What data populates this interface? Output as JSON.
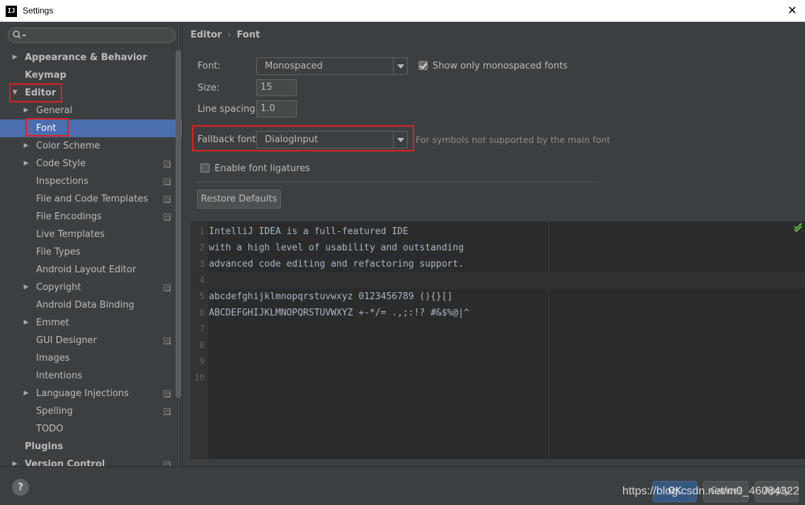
{
  "window": {
    "title": "Settings",
    "app_icon_text": "IJ",
    "close_glyph": "✕"
  },
  "sidebar": {
    "search_placeholder": "",
    "items": [
      {
        "label": "Appearance & Behavior",
        "level": 0,
        "arrow": "▶",
        "bold": true
      },
      {
        "label": "Keymap",
        "level": 0,
        "arrow": "",
        "bold": true
      },
      {
        "label": "Editor",
        "level": 0,
        "arrow": "▼",
        "bold": true
      },
      {
        "label": "General",
        "level": 1,
        "arrow": "▶"
      },
      {
        "label": "Font",
        "level": 1,
        "arrow": "",
        "selected": true
      },
      {
        "label": "Color Scheme",
        "level": 1,
        "arrow": "▶"
      },
      {
        "label": "Code Style",
        "level": 1,
        "arrow": "▶",
        "project_icon": true
      },
      {
        "label": "Inspections",
        "level": 1,
        "arrow": "",
        "project_icon": true
      },
      {
        "label": "File and Code Templates",
        "level": 1,
        "arrow": "",
        "project_icon": true
      },
      {
        "label": "File Encodings",
        "level": 1,
        "arrow": "",
        "project_icon": true
      },
      {
        "label": "Live Templates",
        "level": 1,
        "arrow": ""
      },
      {
        "label": "File Types",
        "level": 1,
        "arrow": ""
      },
      {
        "label": "Android Layout Editor",
        "level": 1,
        "arrow": ""
      },
      {
        "label": "Copyright",
        "level": 1,
        "arrow": "▶",
        "project_icon": true
      },
      {
        "label": "Android Data Binding",
        "level": 1,
        "arrow": ""
      },
      {
        "label": "Emmet",
        "level": 1,
        "arrow": "▶"
      },
      {
        "label": "GUI Designer",
        "level": 1,
        "arrow": "",
        "project_icon": true
      },
      {
        "label": "Images",
        "level": 1,
        "arrow": ""
      },
      {
        "label": "Intentions",
        "level": 1,
        "arrow": ""
      },
      {
        "label": "Language Injections",
        "level": 1,
        "arrow": "▶",
        "project_icon": true
      },
      {
        "label": "Spelling",
        "level": 1,
        "arrow": "",
        "project_icon": true
      },
      {
        "label": "TODO",
        "level": 1,
        "arrow": ""
      },
      {
        "label": "Plugins",
        "level": 0,
        "arrow": "",
        "bold": true
      },
      {
        "label": "Version Control",
        "level": 0,
        "arrow": "▶",
        "bold": true,
        "project_icon": true
      }
    ]
  },
  "breadcrumb": {
    "parent": "Editor",
    "separator": "›",
    "current": "Font"
  },
  "form": {
    "font_label": "Font:",
    "font_value": "Monospaced",
    "show_mono_label": "Show only monospaced fonts",
    "show_mono_checked": true,
    "size_label": "Size:",
    "size_value": "15",
    "line_spacing_label": "Line spacing:",
    "line_spacing_value": "1.0",
    "fallback_label": "Fallback font:",
    "fallback_value": "DialogInput",
    "fallback_hint": "For symbols not supported by the main font",
    "ligatures_label": "Enable font ligatures",
    "ligatures_checked": false,
    "restore_label": "Restore Defaults"
  },
  "preview": {
    "lines": [
      {
        "num": "1",
        "text": "IntelliJ IDEA is a full-featured IDE"
      },
      {
        "num": "2",
        "text": "with a high level of usability and outstanding"
      },
      {
        "num": "3",
        "text": "advanced code editing and refactoring support."
      },
      {
        "num": "4",
        "text": ""
      },
      {
        "num": "5",
        "text": "abcdefghijklmnopqrstuvwxyz 0123456789 (){}[]"
      },
      {
        "num": "6",
        "text": "ABCDEFGHIJKLMNOPQRSTUVWXYZ +-*/= .,;:!? #&$%@|^"
      },
      {
        "num": "7",
        "text": ""
      },
      {
        "num": "8",
        "text": ""
      },
      {
        "num": "9",
        "text": ""
      },
      {
        "num": "10",
        "text": ""
      }
    ]
  },
  "footer": {
    "help_glyph": "?",
    "ok_label": "OK",
    "cancel_label": "Cancel",
    "apply_label": "Apply",
    "watermark": "https://blog.csdn.net/m0_46084322"
  },
  "colors": {
    "background": "#3c3f41",
    "selection": "#4b6eaf",
    "editor_bg": "#2b2b2b",
    "highlight_box": "#e02020"
  }
}
